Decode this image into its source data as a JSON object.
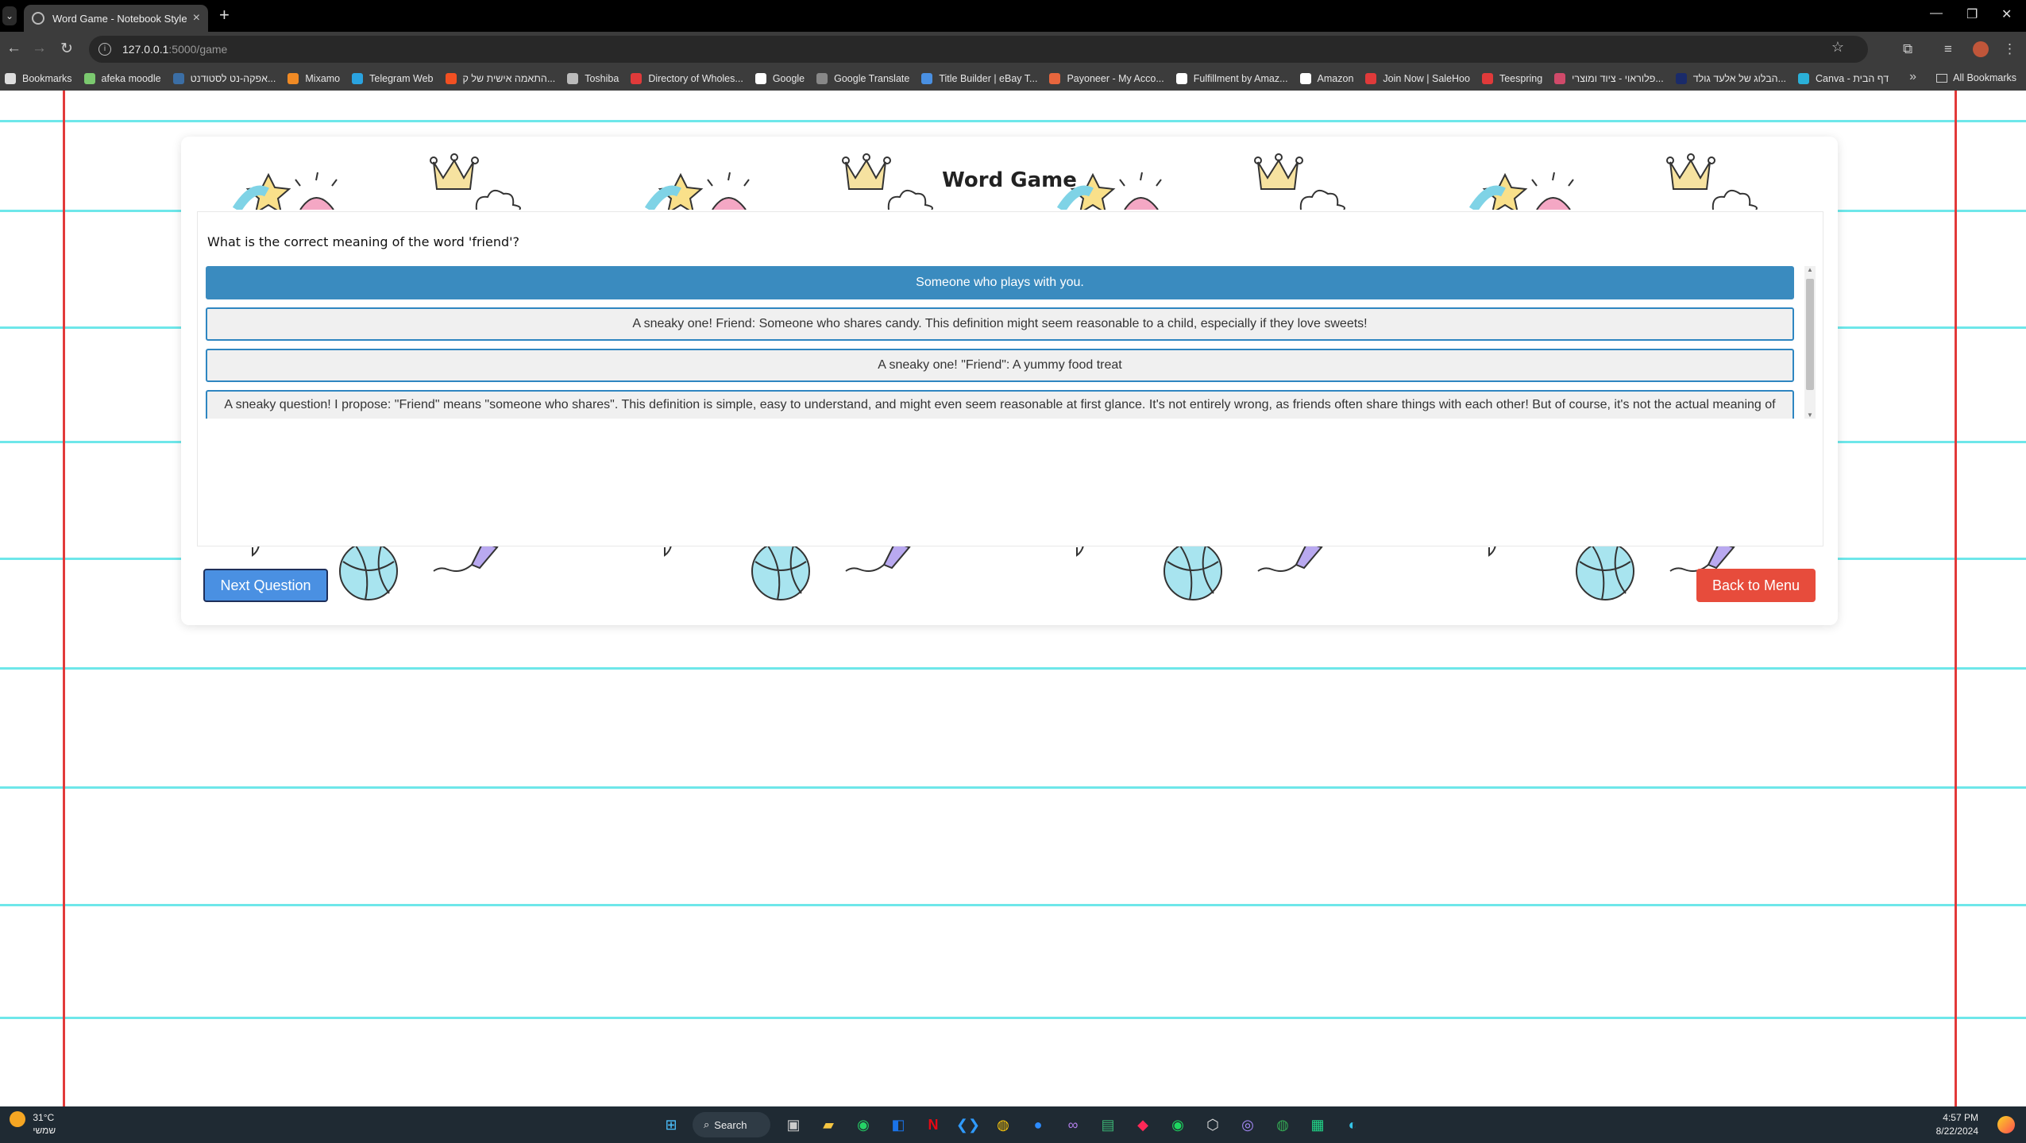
{
  "browser": {
    "tab_title": "Word Game - Notebook Style",
    "tab_close": "×",
    "new_tab": "+",
    "url_host": "127.0.0.1",
    "url_rest": ":5000/game",
    "bookmarks": [
      {
        "label": "Bookmarks",
        "color": "#dddddd"
      },
      {
        "label": "afeka moodle",
        "color": "#7bc96f"
      },
      {
        "label": "אפקה-נט לסטודנט...",
        "color": "#3b6ea5"
      },
      {
        "label": "Mixamo",
        "color": "#f08a24"
      },
      {
        "label": "Telegram Web",
        "color": "#2aa3e0"
      },
      {
        "label": "התאמה אישית של ק...",
        "color": "#f25022"
      },
      {
        "label": "Toshiba",
        "color": "#bbbbbb"
      },
      {
        "label": "Directory of Wholes...",
        "color": "#e03a3a"
      },
      {
        "label": "Google",
        "color": "#ffffff"
      },
      {
        "label": "Google Translate",
        "color": "#888888"
      },
      {
        "label": "Title Builder | eBay T...",
        "color": "#4a90e2"
      },
      {
        "label": "Payoneer - My Acco...",
        "color": "#e8663d"
      },
      {
        "label": "Fulfillment by Amaz...",
        "color": "#ffffff"
      },
      {
        "label": "Amazon",
        "color": "#ffffff"
      },
      {
        "label": "Join Now | SaleHoo",
        "color": "#e03a3a"
      },
      {
        "label": "Teespring",
        "color": "#e03a3a"
      },
      {
        "label": "פלוראוי - ציוד ומוצרי...",
        "color": "#d04a6a"
      },
      {
        "label": "הבלוג של אלעד גולד...",
        "color": "#1a2b6a"
      },
      {
        "label": "Canva - דף הבית",
        "color": "#2ab0d8"
      }
    ],
    "all_bookmarks": "All Bookmarks"
  },
  "game": {
    "title": "Word Game",
    "question": "What is the correct meaning of the word 'friend'?",
    "answers": [
      {
        "text": "Someone who plays with you.",
        "selected": true
      },
      {
        "text": "A sneaky one! Friend: Someone who shares candy. This definition might seem reasonable to a child, especially if they love sweets!",
        "selected": false
      },
      {
        "text": "A sneaky one! \"Friend\": A yummy food treat",
        "selected": false
      },
      {
        "text": "A sneaky question! I propose: \"Friend\" means \"someone who shares\". This definition is simple, easy to understand, and might even seem reasonable at first glance. It's not entirely wrong, as friends often share things with each other! But of course, it's not the actual meaning of",
        "selected": false
      }
    ],
    "next_button": "Next Question",
    "back_button": "Back to Menu"
  },
  "taskbar": {
    "temperature": "31°C",
    "weather_text": "שמשי",
    "search_label": "Search",
    "time": "4:57 PM",
    "date": "8/22/2024"
  },
  "colors": {
    "notebook_line": "#6ee7ea",
    "margin_line": "#e23a3a",
    "selected_answer": "#3a8bbf",
    "next_button": "#4a90e2",
    "back_button": "#e74c3c"
  }
}
